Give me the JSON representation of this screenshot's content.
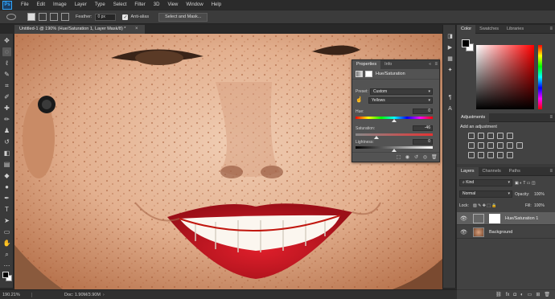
{
  "menubar": {
    "logo": "Ps",
    "items": [
      "File",
      "Edit",
      "Image",
      "Layer",
      "Type",
      "Select",
      "Filter",
      "3D",
      "View",
      "Window",
      "Help"
    ]
  },
  "options": {
    "feather_label": "Feather:",
    "feather_value": "0 px",
    "antialias_label": "Anti-alias",
    "antialias_checked": true,
    "select_mask_label": "Select and Mask..."
  },
  "document": {
    "tab_title": "Untitled-1 @ 190% (Hue/Saturation 1, Layer Mask/8) *",
    "close_glyph": "×"
  },
  "status": {
    "zoom": "190.21%",
    "doc_info": "Doc: 1.90M/3.90M",
    "arrow": "›"
  },
  "properties": {
    "tabs": [
      "Properties",
      "Info"
    ],
    "adjustment_title": "Hue/Saturation",
    "preset_label": "Preset:",
    "preset_value": "Custom",
    "channel_value": "Yellows",
    "hue_label": "Hue:",
    "hue_value": "0",
    "saturation_label": "Saturation:",
    "saturation_value": "-46",
    "lightness_label": "Lightness:",
    "lightness_value": "0",
    "hue_fraction": 0.5,
    "saturation_fraction": 0.27,
    "lightness_fraction": 0.5,
    "icons": [
      "clip-to-layer-icon",
      "view-previous-icon",
      "reset-icon",
      "visibility-icon",
      "trash-icon"
    ]
  },
  "color_panel": {
    "tabs": [
      "Color",
      "Swatches",
      "Libraries"
    ],
    "fg_color": "#000000",
    "bg_color": "#ffffff",
    "hue_color": "#ff0000"
  },
  "adjustments_panel": {
    "tab": "Adjustments",
    "title": "Add an adjustment"
  },
  "layers_panel": {
    "tabs": [
      "Layers",
      "Channels",
      "Paths"
    ],
    "kind_label": "Kind",
    "blend_mode": "Normal",
    "opacity_label": "Opacity:",
    "opacity_value": "100%",
    "lock_label": "Lock:",
    "fill_label": "Fill:",
    "fill_value": "100%",
    "layers": [
      {
        "name": "Hue/Saturation 1",
        "selected": true,
        "type": "adjustment"
      },
      {
        "name": "Background",
        "selected": false,
        "type": "image"
      }
    ]
  }
}
